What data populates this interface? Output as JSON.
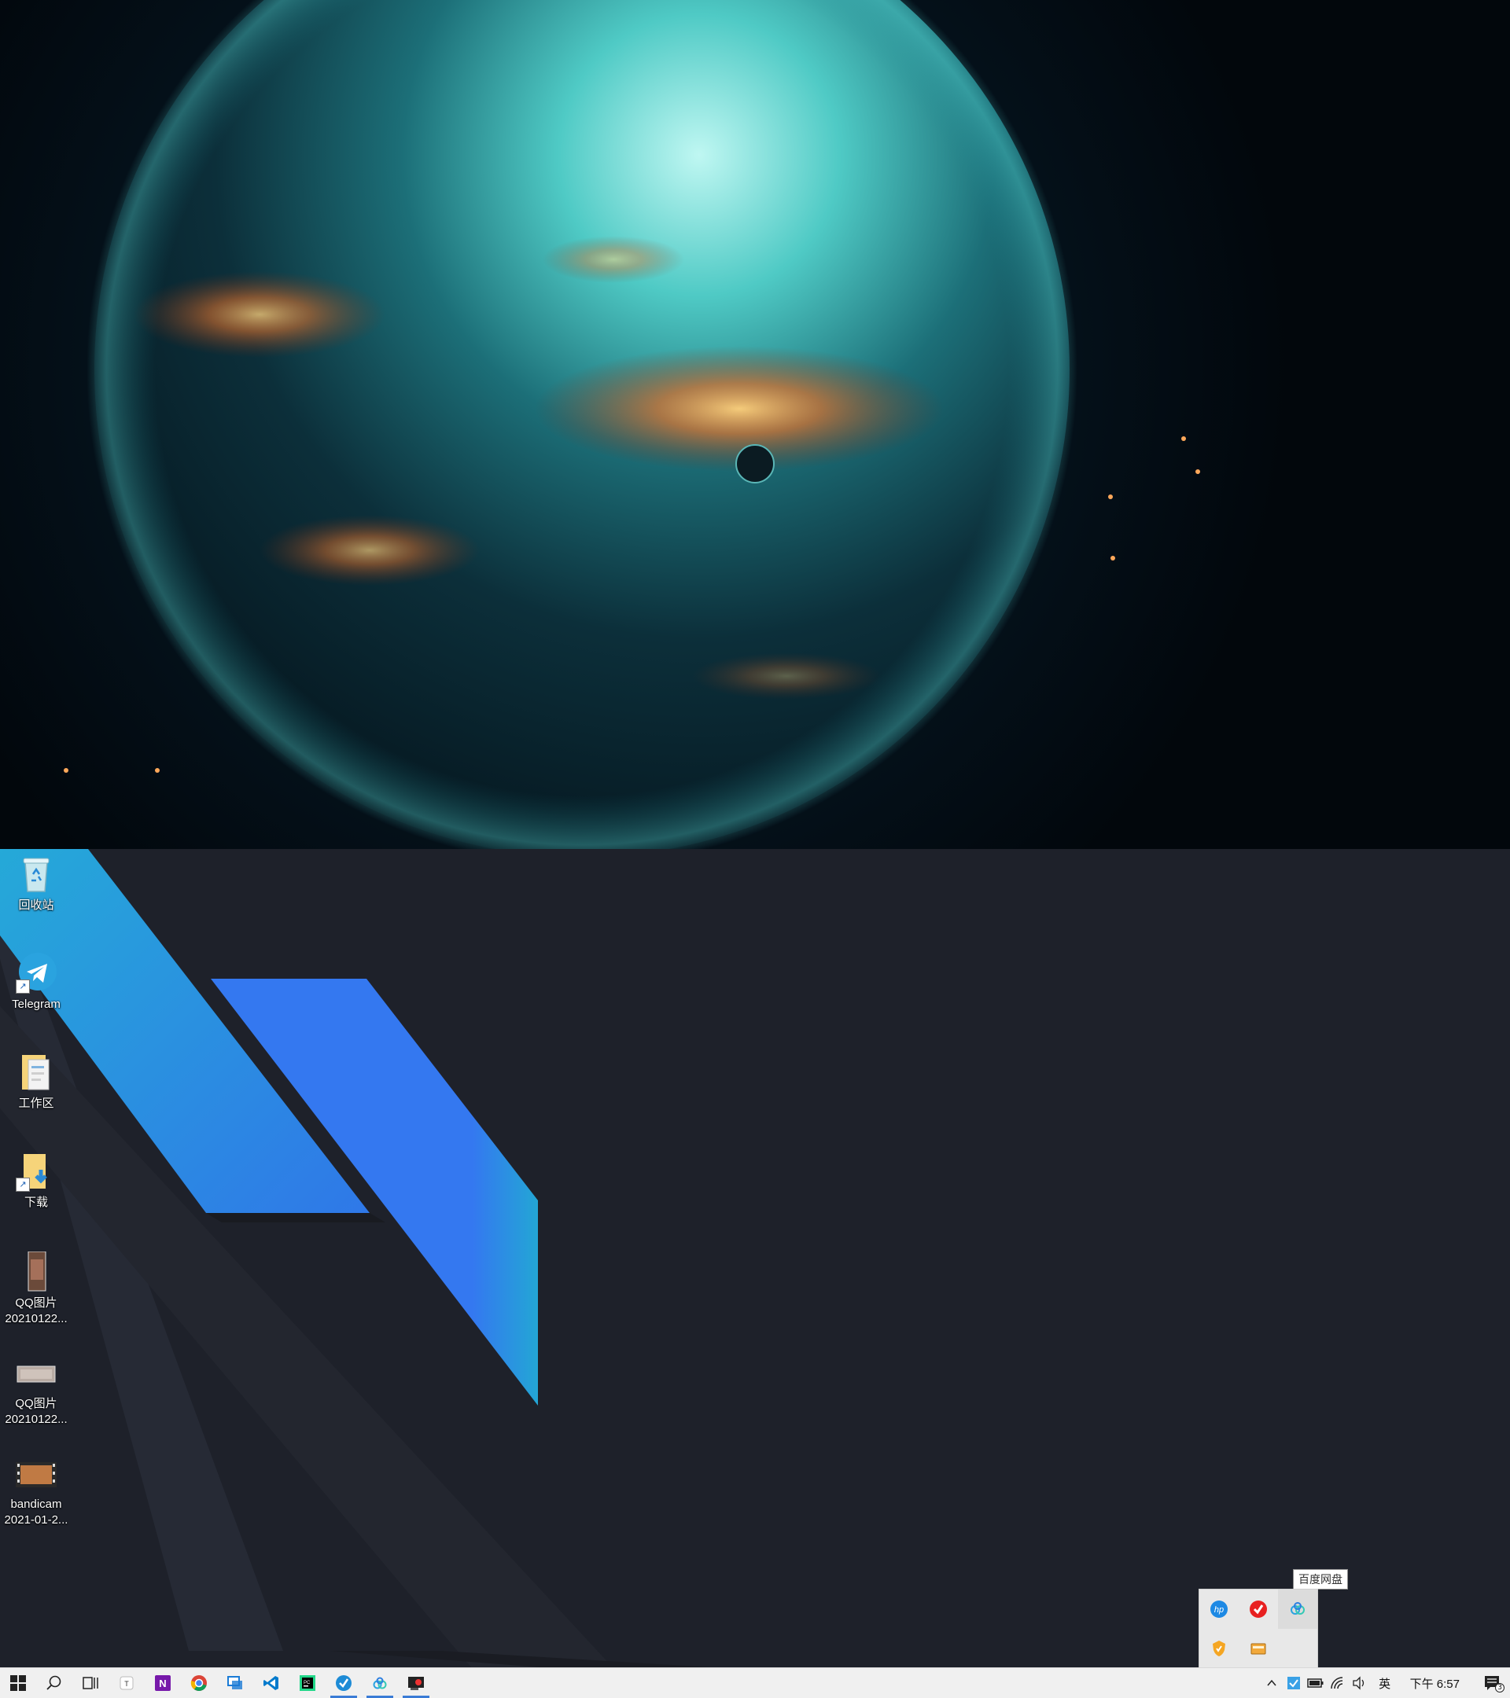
{
  "desktop_icons": [
    {
      "label": "回收站",
      "label2": "",
      "icon": "recycle-bin-icon"
    },
    {
      "label": "Telegram",
      "label2": "",
      "icon": "telegram-icon"
    },
    {
      "label": "工作区",
      "label2": "",
      "icon": "folder-icon"
    },
    {
      "label": "下载",
      "label2": "",
      "icon": "downloads-folder-icon"
    },
    {
      "label": "QQ图片",
      "label2": "20210122...",
      "icon": "image-file-icon"
    },
    {
      "label": "QQ图片",
      "label2": "20210122...",
      "icon": "image-file-icon"
    },
    {
      "label": "bandicam",
      "label2": "2021-01-2...",
      "icon": "video-file-icon"
    }
  ],
  "taskbar": {
    "pinned": [
      {
        "name": "start-button",
        "icon": "windows-logo-icon"
      },
      {
        "name": "search-button",
        "icon": "search-icon"
      },
      {
        "name": "task-view-button",
        "icon": "task-view-icon"
      },
      {
        "name": "app-typora",
        "icon": "typora-icon"
      },
      {
        "name": "app-onenote",
        "icon": "onenote-icon"
      },
      {
        "name": "app-chrome",
        "icon": "chrome-icon"
      },
      {
        "name": "app-remote",
        "icon": "remote-desktop-icon"
      },
      {
        "name": "app-vscode",
        "icon": "vscode-icon"
      },
      {
        "name": "app-pycharm",
        "icon": "pycharm-icon"
      },
      {
        "name": "app-yuque",
        "icon": "yuque-icon",
        "active": true
      },
      {
        "name": "app-baidu-netdisk",
        "icon": "baidu-netdisk-icon",
        "active": true
      },
      {
        "name": "app-bandicam",
        "icon": "bandicam-icon",
        "active": true
      }
    ],
    "tray": {
      "chevron": "^",
      "ime": "英",
      "clock": "下午 6:57",
      "notification_count": "3"
    }
  },
  "tray_overflow": {
    "tooltip": "百度网盘",
    "icons": [
      "hp-icon",
      "yandex-icon",
      "baidu-netdisk-icon",
      "security-icon",
      "card-reader-icon"
    ]
  },
  "colors": {
    "taskbar_bg": "#f0f0f0",
    "wallpaper_bottom_bg": "#1e212a",
    "accent_blue": "#3478f0",
    "accent_cyan": "#23a6d5"
  }
}
